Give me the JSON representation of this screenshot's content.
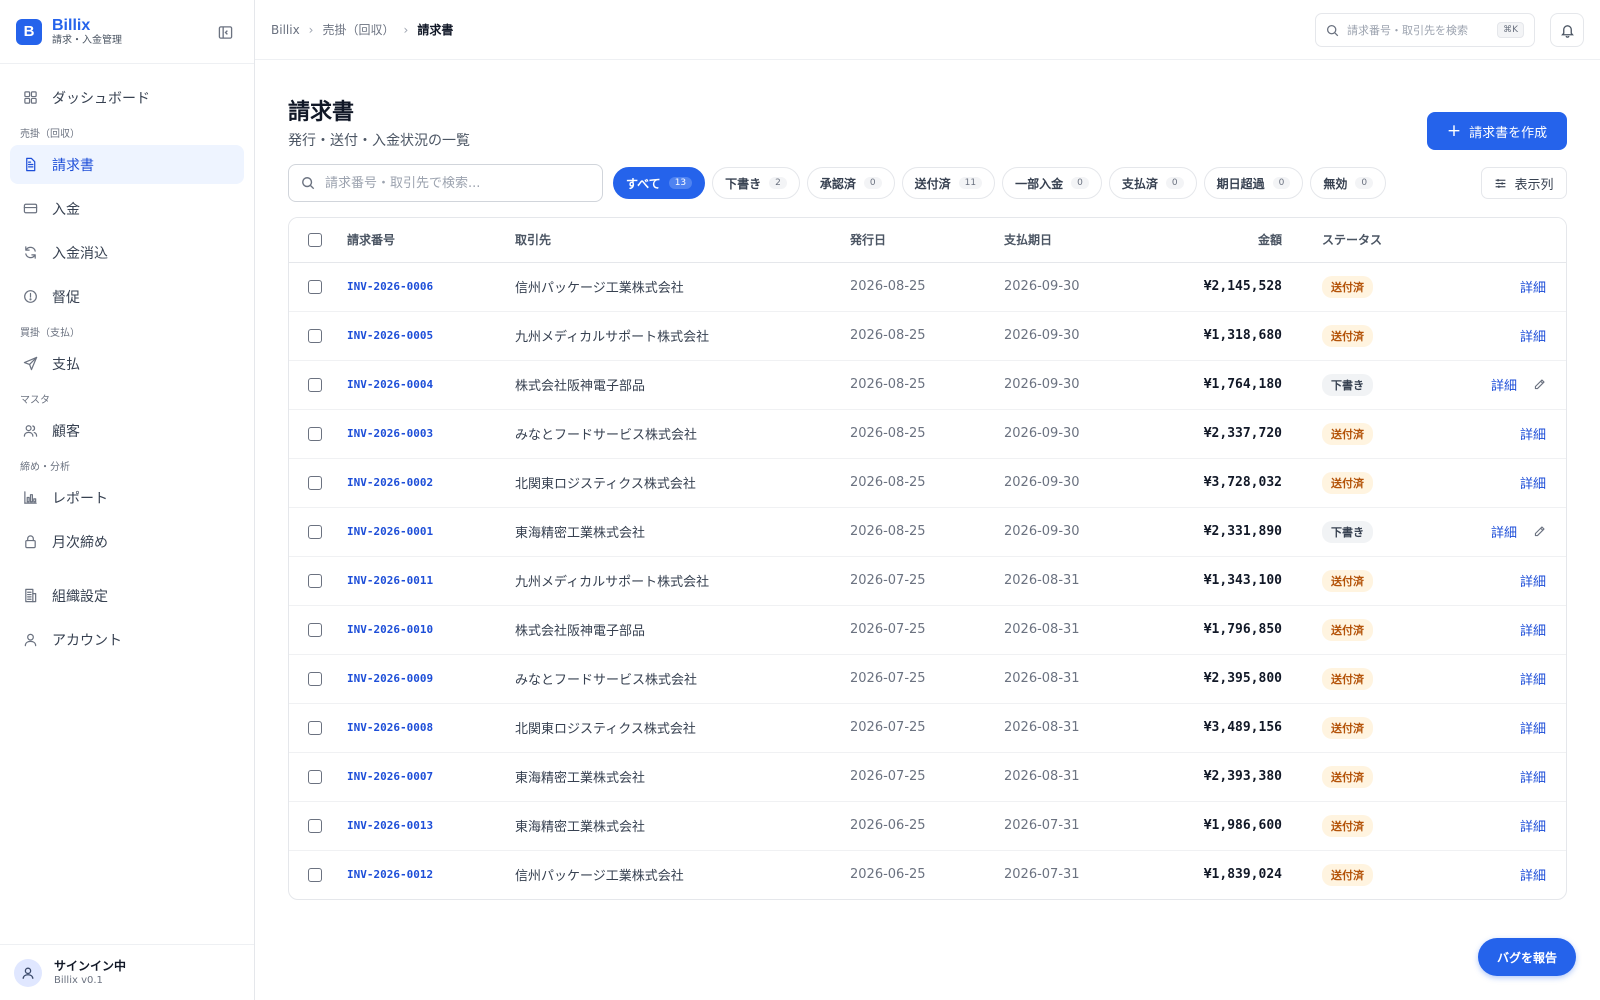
{
  "brand": {
    "logo_letter": "B",
    "name": "Billix",
    "subtitle": "請求・入金管理"
  },
  "sidebar": {
    "items": [
      {
        "label": "ダッシュボード",
        "icon": "dashboard-icon"
      },
      {
        "section": "売掛（回収）"
      },
      {
        "label": "請求書",
        "icon": "document-icon",
        "active": true
      },
      {
        "label": "入金",
        "icon": "card-icon"
      },
      {
        "label": "入金消込",
        "icon": "refresh-icon"
      },
      {
        "label": "督促",
        "icon": "alert-circle-icon"
      },
      {
        "section": "買掛（支払）"
      },
      {
        "label": "支払",
        "icon": "send-icon"
      },
      {
        "section": "マスタ"
      },
      {
        "label": "顧客",
        "icon": "users-icon"
      },
      {
        "section": "締め・分析"
      },
      {
        "label": "レポート",
        "icon": "bar-chart-icon"
      },
      {
        "label": "月次締め",
        "icon": "lock-icon"
      },
      {
        "label": "組織設定",
        "icon": "building-icon"
      },
      {
        "label": "アカウント",
        "icon": "user-icon"
      }
    ],
    "user": {
      "status": "サインイン中",
      "version": "Billix v0.1"
    }
  },
  "topbar": {
    "breadcrumb": [
      "Billix",
      "売掛（回収）",
      "請求書"
    ],
    "search_placeholder": "請求番号・取引先を検索",
    "search_shortcut": "⌘K"
  },
  "page": {
    "title": "請求書",
    "subtitle": "発行・送付・入金状況の一覧",
    "create_label": "請求書を作成",
    "list_search_placeholder": "請求番号・取引先で検索...",
    "columns_button": "表示列"
  },
  "filters": [
    {
      "label": "すべて",
      "count": "13",
      "active": true
    },
    {
      "label": "下書き",
      "count": "2"
    },
    {
      "label": "承認済",
      "count": "0"
    },
    {
      "label": "送付済",
      "count": "11"
    },
    {
      "label": "一部入金",
      "count": "0"
    },
    {
      "label": "支払済",
      "count": "0"
    },
    {
      "label": "期日超過",
      "count": "0"
    },
    {
      "label": "無効",
      "count": "0"
    }
  ],
  "table": {
    "headers": {
      "number": "請求番号",
      "client": "取引先",
      "issue": "発行日",
      "due": "支払期日",
      "amount": "金額",
      "status": "ステータス"
    },
    "detail_label": "詳細",
    "rows": [
      {
        "number": "INV-2026-0006",
        "client": "信州パッケージ工業株式会社",
        "issue": "2026-08-25",
        "due": "2026-09-30",
        "amount": "¥2,145,528",
        "status": "送付済",
        "status_type": "sent"
      },
      {
        "number": "INV-2026-0005",
        "client": "九州メディカルサポート株式会社",
        "issue": "2026-08-25",
        "due": "2026-09-30",
        "amount": "¥1,318,680",
        "status": "送付済",
        "status_type": "sent"
      },
      {
        "number": "INV-2026-0004",
        "client": "株式会社阪神電子部品",
        "issue": "2026-08-25",
        "due": "2026-09-30",
        "amount": "¥1,764,180",
        "status": "下書き",
        "status_type": "draft"
      },
      {
        "number": "INV-2026-0003",
        "client": "みなとフードサービス株式会社",
        "issue": "2026-08-25",
        "due": "2026-09-30",
        "amount": "¥2,337,720",
        "status": "送付済",
        "status_type": "sent"
      },
      {
        "number": "INV-2026-0002",
        "client": "北関東ロジスティクス株式会社",
        "issue": "2026-08-25",
        "due": "2026-09-30",
        "amount": "¥3,728,032",
        "status": "送付済",
        "status_type": "sent"
      },
      {
        "number": "INV-2026-0001",
        "client": "東海精密工業株式会社",
        "issue": "2026-08-25",
        "due": "2026-09-30",
        "amount": "¥2,331,890",
        "status": "下書き",
        "status_type": "draft"
      },
      {
        "number": "INV-2026-0011",
        "client": "九州メディカルサポート株式会社",
        "issue": "2026-07-25",
        "due": "2026-08-31",
        "amount": "¥1,343,100",
        "status": "送付済",
        "status_type": "sent"
      },
      {
        "number": "INV-2026-0010",
        "client": "株式会社阪神電子部品",
        "issue": "2026-07-25",
        "due": "2026-08-31",
        "amount": "¥1,796,850",
        "status": "送付済",
        "status_type": "sent"
      },
      {
        "number": "INV-2026-0009",
        "client": "みなとフードサービス株式会社",
        "issue": "2026-07-25",
        "due": "2026-08-31",
        "amount": "¥2,395,800",
        "status": "送付済",
        "status_type": "sent"
      },
      {
        "number": "INV-2026-0008",
        "client": "北関東ロジスティクス株式会社",
        "issue": "2026-07-25",
        "due": "2026-08-31",
        "amount": "¥3,489,156",
        "status": "送付済",
        "status_type": "sent"
      },
      {
        "number": "INV-2026-0007",
        "client": "東海精密工業株式会社",
        "issue": "2026-07-25",
        "due": "2026-08-31",
        "amount": "¥2,393,380",
        "status": "送付済",
        "status_type": "sent"
      },
      {
        "number": "INV-2026-0013",
        "client": "東海精密工業株式会社",
        "issue": "2026-06-25",
        "due": "2026-07-31",
        "amount": "¥1,986,600",
        "status": "送付済",
        "status_type": "sent"
      },
      {
        "number": "INV-2026-0012",
        "client": "信州パッケージ工業株式会社",
        "issue": "2026-06-25",
        "due": "2026-07-31",
        "amount": "¥1,839,024",
        "status": "送付済",
        "status_type": "sent"
      }
    ]
  },
  "bug_report_label": "バグを報告",
  "colors": {
    "accent": "#2563eb",
    "sent_bg": "#fff4e0",
    "sent_fg": "#b45309",
    "draft_bg": "#f1f3f5"
  }
}
